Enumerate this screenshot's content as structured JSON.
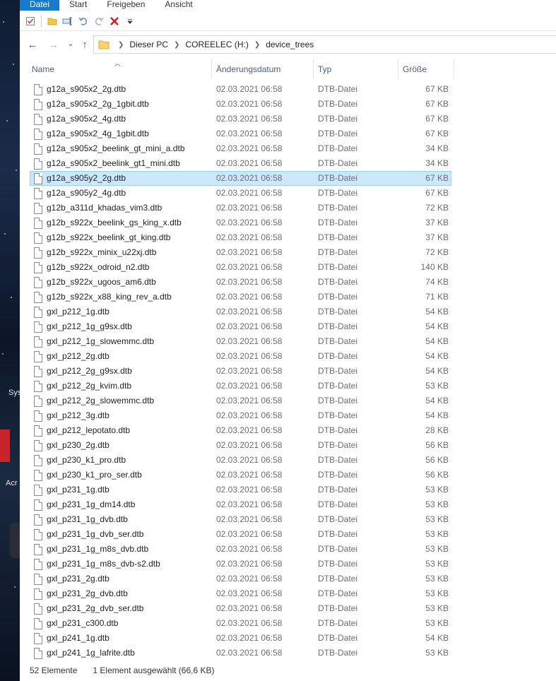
{
  "desktop": {
    "labels": [
      "Sys",
      "Acr"
    ]
  },
  "ribbon": {
    "tabs": [
      "Datei",
      "Start",
      "Freigeben",
      "Ansicht"
    ]
  },
  "quick_access": {
    "icons": [
      "properties-icon",
      "new-folder-icon",
      "rename-icon",
      "undo-icon",
      "redo-icon",
      "delete-icon",
      "customize-dropdown-icon"
    ]
  },
  "navigation": {
    "back": "←",
    "forward": "→",
    "recent": "⌄",
    "up": "↑",
    "breadcrumb": [
      "Dieser PC",
      "COREELEC (H:)",
      "device_trees"
    ]
  },
  "columns": {
    "name": "Name",
    "date": "Änderungsdatum",
    "type": "Typ",
    "size": "Größe"
  },
  "files": [
    {
      "name": "g12a_s905x2_2g.dtb",
      "date": "02.03.2021 06:58",
      "type": "DTB-Datei",
      "size": "67 KB",
      "selected": false
    },
    {
      "name": "g12a_s905x2_2g_1gbit.dtb",
      "date": "02.03.2021 06:58",
      "type": "DTB-Datei",
      "size": "67 KB",
      "selected": false
    },
    {
      "name": "g12a_s905x2_4g.dtb",
      "date": "02.03.2021 06:58",
      "type": "DTB-Datei",
      "size": "67 KB",
      "selected": false
    },
    {
      "name": "g12a_s905x2_4g_1gbit.dtb",
      "date": "02.03.2021 06:58",
      "type": "DTB-Datei",
      "size": "67 KB",
      "selected": false
    },
    {
      "name": "g12a_s905x2_beelink_gt_mini_a.dtb",
      "date": "02.03.2021 06:58",
      "type": "DTB-Datei",
      "size": "34 KB",
      "selected": false
    },
    {
      "name": "g12a_s905x2_beelink_gt1_mini.dtb",
      "date": "02.03.2021 06:58",
      "type": "DTB-Datei",
      "size": "34 KB",
      "selected": false
    },
    {
      "name": "g12a_s905y2_2g.dtb",
      "date": "02.03.2021 06:58",
      "type": "DTB-Datei",
      "size": "67 KB",
      "selected": true
    },
    {
      "name": "g12a_s905y2_4g.dtb",
      "date": "02.03.2021 06:58",
      "type": "DTB-Datei",
      "size": "67 KB",
      "selected": false
    },
    {
      "name": "g12b_a311d_khadas_vim3.dtb",
      "date": "02.03.2021 06:58",
      "type": "DTB-Datei",
      "size": "72 KB",
      "selected": false
    },
    {
      "name": "g12b_s922x_beelink_gs_king_x.dtb",
      "date": "02.03.2021 06:58",
      "type": "DTB-Datei",
      "size": "37 KB",
      "selected": false
    },
    {
      "name": "g12b_s922x_beelink_gt_king.dtb",
      "date": "02.03.2021 06:58",
      "type": "DTB-Datei",
      "size": "37 KB",
      "selected": false
    },
    {
      "name": "g12b_s922x_minix_u22xj.dtb",
      "date": "02.03.2021 06:58",
      "type": "DTB-Datei",
      "size": "72 KB",
      "selected": false
    },
    {
      "name": "g12b_s922x_odroid_n2.dtb",
      "date": "02.03.2021 06:58",
      "type": "DTB-Datei",
      "size": "140 KB",
      "selected": false
    },
    {
      "name": "g12b_s922x_ugoos_am6.dtb",
      "date": "02.03.2021 06:58",
      "type": "DTB-Datei",
      "size": "74 KB",
      "selected": false
    },
    {
      "name": "g12b_s922x_x88_king_rev_a.dtb",
      "date": "02.03.2021 06:58",
      "type": "DTB-Datei",
      "size": "71 KB",
      "selected": false
    },
    {
      "name": "gxl_p212_1g.dtb",
      "date": "02.03.2021 06:58",
      "type": "DTB-Datei",
      "size": "54 KB",
      "selected": false
    },
    {
      "name": "gxl_p212_1g_g9sx.dtb",
      "date": "02.03.2021 06:58",
      "type": "DTB-Datei",
      "size": "54 KB",
      "selected": false
    },
    {
      "name": "gxl_p212_1g_slowemmc.dtb",
      "date": "02.03.2021 06:58",
      "type": "DTB-Datei",
      "size": "54 KB",
      "selected": false
    },
    {
      "name": "gxl_p212_2g.dtb",
      "date": "02.03.2021 06:58",
      "type": "DTB-Datei",
      "size": "54 KB",
      "selected": false
    },
    {
      "name": "gxl_p212_2g_g9sx.dtb",
      "date": "02.03.2021 06:58",
      "type": "DTB-Datei",
      "size": "54 KB",
      "selected": false
    },
    {
      "name": "gxl_p212_2g_kvim.dtb",
      "date": "02.03.2021 06:58",
      "type": "DTB-Datei",
      "size": "53 KB",
      "selected": false
    },
    {
      "name": "gxl_p212_2g_slowemmc.dtb",
      "date": "02.03.2021 06:58",
      "type": "DTB-Datei",
      "size": "54 KB",
      "selected": false
    },
    {
      "name": "gxl_p212_3g.dtb",
      "date": "02.03.2021 06:58",
      "type": "DTB-Datei",
      "size": "54 KB",
      "selected": false
    },
    {
      "name": "gxl_p212_lepotato.dtb",
      "date": "02.03.2021 06:58",
      "type": "DTB-Datei",
      "size": "28 KB",
      "selected": false
    },
    {
      "name": "gxl_p230_2g.dtb",
      "date": "02.03.2021 06:58",
      "type": "DTB-Datei",
      "size": "56 KB",
      "selected": false
    },
    {
      "name": "gxl_p230_k1_pro.dtb",
      "date": "02.03.2021 06:58",
      "type": "DTB-Datei",
      "size": "56 KB",
      "selected": false
    },
    {
      "name": "gxl_p230_k1_pro_ser.dtb",
      "date": "02.03.2021 06:58",
      "type": "DTB-Datei",
      "size": "56 KB",
      "selected": false
    },
    {
      "name": "gxl_p231_1g.dtb",
      "date": "02.03.2021 06:58",
      "type": "DTB-Datei",
      "size": "53 KB",
      "selected": false
    },
    {
      "name": "gxl_p231_1g_dm14.dtb",
      "date": "02.03.2021 06:58",
      "type": "DTB-Datei",
      "size": "53 KB",
      "selected": false
    },
    {
      "name": "gxl_p231_1g_dvb.dtb",
      "date": "02.03.2021 06:58",
      "type": "DTB-Datei",
      "size": "53 KB",
      "selected": false
    },
    {
      "name": "gxl_p231_1g_dvb_ser.dtb",
      "date": "02.03.2021 06:58",
      "type": "DTB-Datei",
      "size": "53 KB",
      "selected": false
    },
    {
      "name": "gxl_p231_1g_m8s_dvb.dtb",
      "date": "02.03.2021 06:58",
      "type": "DTB-Datei",
      "size": "53 KB",
      "selected": false
    },
    {
      "name": "gxl_p231_1g_m8s_dvb-s2.dtb",
      "date": "02.03.2021 06:58",
      "type": "DTB-Datei",
      "size": "53 KB",
      "selected": false
    },
    {
      "name": "gxl_p231_2g.dtb",
      "date": "02.03.2021 06:58",
      "type": "DTB-Datei",
      "size": "53 KB",
      "selected": false
    },
    {
      "name": "gxl_p231_2g_dvb.dtb",
      "date": "02.03.2021 06:58",
      "type": "DTB-Datei",
      "size": "53 KB",
      "selected": false
    },
    {
      "name": "gxl_p231_2g_dvb_ser.dtb",
      "date": "02.03.2021 06:58",
      "type": "DTB-Datei",
      "size": "53 KB",
      "selected": false
    },
    {
      "name": "gxl_p231_c300.dtb",
      "date": "02.03.2021 06:58",
      "type": "DTB-Datei",
      "size": "53 KB",
      "selected": false
    },
    {
      "name": "gxl_p241_1g.dtb",
      "date": "02.03.2021 06:58",
      "type": "DTB-Datei",
      "size": "54 KB",
      "selected": false
    },
    {
      "name": "gxl_p241_1g_lafrite.dtb",
      "date": "02.03.2021 06:58",
      "type": "DTB-Datei",
      "size": "53 KB",
      "selected": false
    }
  ],
  "status": {
    "count": "52 Elemente",
    "selection": "1 Element ausgewählt (66,6 KB)"
  },
  "colors": {
    "accent": "#1979ca",
    "selection_bg": "#cce8ff",
    "selection_border": "#99d1ff",
    "header_text": "#4c607a"
  }
}
